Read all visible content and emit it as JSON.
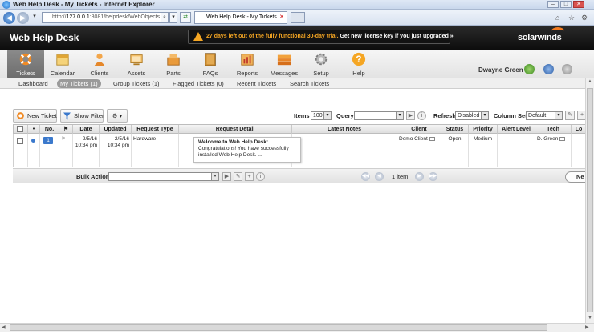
{
  "browser": {
    "window_title": "Web Help Desk - My Tickets - Internet Explorer",
    "address_prefix": "http://",
    "address_domain": "127.0.0.1",
    "address_rest": ":8081/helpdesk/WebObjects",
    "tab_title": "Web Help Desk - My Tickets"
  },
  "app": {
    "brand": "Web Help Desk",
    "trial_days": "27 days left out of the fully functional 30-day trial.",
    "trial_link": "Get new license key if you just upgraded »",
    "logo": "solarwinds",
    "user_name": "Dwayne Green"
  },
  "nav": [
    {
      "label": "Tickets",
      "icon": "lifebuoy-icon",
      "active": true
    },
    {
      "label": "Calendar",
      "icon": "calendar-icon"
    },
    {
      "label": "Clients",
      "icon": "clients-icon"
    },
    {
      "label": "Assets",
      "icon": "assets-icon"
    },
    {
      "label": "Parts",
      "icon": "parts-icon"
    },
    {
      "label": "FAQs",
      "icon": "faqs-icon"
    },
    {
      "label": "Reports",
      "icon": "reports-icon"
    },
    {
      "label": "Messages",
      "icon": "messages-icon"
    },
    {
      "label": "Setup",
      "icon": "setup-gear-icon"
    },
    {
      "label": "Help",
      "icon": "help-icon"
    }
  ],
  "subnav": [
    {
      "label": "Dashboard"
    },
    {
      "label": "My Tickets (1)",
      "active": true
    },
    {
      "label": "Group Tickets (1)"
    },
    {
      "label": "Flagged Tickets (0)"
    },
    {
      "label": "Recent Tickets"
    },
    {
      "label": "Search Tickets"
    }
  ],
  "toolbar": {
    "new_ticket": "New Ticket",
    "show_filter": "Show Filter",
    "items_label": "Items",
    "items_value": "100",
    "query_label": "Query",
    "query_value": "",
    "refresh_label": "Refresh",
    "refresh_value": "Disabled",
    "column_set_label": "Column Set",
    "column_set_value": "Default"
  },
  "columns": [
    "No.",
    "Date",
    "Updated",
    "Request Type",
    "Request Detail",
    "Latest Notes",
    "Client",
    "Status",
    "Priority",
    "Alert Level",
    "Tech",
    "Lo"
  ],
  "ticket": {
    "number": "1",
    "date": "2/5/16",
    "date_time": "10:34 pm",
    "updated": "2/5/16",
    "updated_time": "10:34 pm",
    "request_type": "Hardware",
    "detail_subject": "Welcome to Web Help Desk:",
    "detail_body": "Congratulations! You have successfully installed Web Help Desk. ...",
    "latest_notes": "",
    "client": "Demo Client",
    "status": "Open",
    "priority": "Medium",
    "alert_level": "",
    "tech": "D. Green"
  },
  "bottom": {
    "bulk_action_label": "Bulk Action",
    "bulk_action_value": "",
    "item_count": "1 item",
    "next_label": "Ne"
  },
  "colors": {
    "header_bg": "#111111",
    "trial_accent": "#f5a623",
    "logo_accent": "#f47b20",
    "active_nav": "#7a7a7a",
    "ticket_badge": "#3b79cc"
  }
}
